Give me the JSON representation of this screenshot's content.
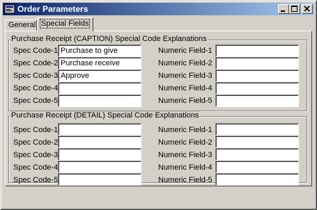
{
  "window": {
    "title": "Order Parameters",
    "minimize_glyph": "_",
    "maximize_glyph": "□",
    "close_glyph": "×"
  },
  "tabs": [
    {
      "label": "General",
      "active": false
    },
    {
      "label": "Special Fields",
      "active": true
    }
  ],
  "caption_group": {
    "title": "Purchase Receipt  (CAPTION)  Special Code Explanations",
    "spec_codes": [
      {
        "label": "Spec Code-1",
        "value": "Purchase to give"
      },
      {
        "label": "Spec Code-2",
        "value": "Purchase receive"
      },
      {
        "label": "Spec Code-3",
        "value": "Approve"
      },
      {
        "label": "Spec Code-4",
        "value": ""
      },
      {
        "label": "Spec Code-5",
        "value": ""
      }
    ],
    "numeric_fields": [
      {
        "label": "Numeric Field-1",
        "value": ""
      },
      {
        "label": "Numeric Field-2",
        "value": ""
      },
      {
        "label": "Numeric Field-3",
        "value": ""
      },
      {
        "label": "Numeric Field-4",
        "value": ""
      },
      {
        "label": "Numeric Field-5",
        "value": ""
      }
    ]
  },
  "detail_group": {
    "title": "Purchase Receipt  (DETAIL)  Special Code Explanations",
    "spec_codes": [
      {
        "label": "Spec Code-1",
        "value": ""
      },
      {
        "label": "Spec Code-2",
        "value": ""
      },
      {
        "label": "Spec Code-3",
        "value": ""
      },
      {
        "label": "Spec Code-4",
        "value": ""
      },
      {
        "label": "Spec Code-5",
        "value": ""
      }
    ],
    "numeric_fields": [
      {
        "label": "Numeric Field-1",
        "value": ""
      },
      {
        "label": "Numeric Field-2",
        "value": ""
      },
      {
        "label": "Numeric Field-3",
        "value": ""
      },
      {
        "label": "Numeric Field-4",
        "value": ""
      },
      {
        "label": "Numeric Field-5",
        "value": ""
      }
    ]
  }
}
